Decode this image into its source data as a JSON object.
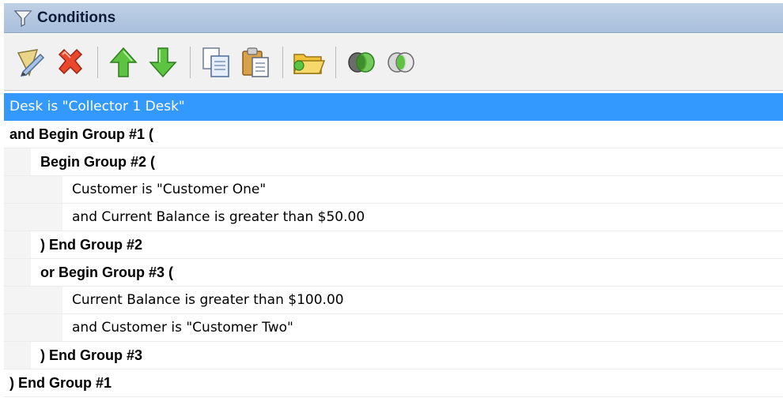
{
  "panel": {
    "title": "Conditions",
    "title_icon": "funnel-icon"
  },
  "toolbar": {
    "buttons": [
      {
        "icon": "edit-condition-icon"
      },
      {
        "icon": "delete-icon"
      },
      {
        "icon": "move-up-icon"
      },
      {
        "icon": "move-down-icon"
      },
      {
        "icon": "copy-icon"
      },
      {
        "icon": "paste-icon"
      },
      {
        "icon": "folder-icon"
      },
      {
        "icon": "group-icon"
      },
      {
        "icon": "ungroup-icon"
      }
    ]
  },
  "conditions": [
    {
      "text": "Desk is \"Collector 1 Desk\"",
      "level": 0,
      "kind": "condition",
      "selected": true
    },
    {
      "text": "and Begin Group #1 (",
      "level": 0,
      "kind": "group",
      "selected": false
    },
    {
      "text": "Begin Group #2 (",
      "level": 1,
      "kind": "group",
      "selected": false
    },
    {
      "text": "Customer is \"Customer One\"",
      "level": 2,
      "kind": "condition",
      "selected": false
    },
    {
      "text": "and Current Balance is greater than $50.00",
      "level": 2,
      "kind": "condition",
      "selected": false
    },
    {
      "text": ") End Group #2",
      "level": 1,
      "kind": "group",
      "selected": false
    },
    {
      "text": "or Begin Group #3 (",
      "level": 1,
      "kind": "group",
      "selected": false
    },
    {
      "text": "Current Balance is greater than $100.00",
      "level": 2,
      "kind": "condition",
      "selected": false
    },
    {
      "text": "and Customer is \"Customer Two\"",
      "level": 2,
      "kind": "condition",
      "selected": false
    },
    {
      "text": ") End Group #3",
      "level": 1,
      "kind": "group",
      "selected": false
    },
    {
      "text": ") End Group #1",
      "level": 0,
      "kind": "group",
      "selected": false
    }
  ],
  "colors": {
    "selection": "#3399ff",
    "title_bar": "#b3c6e0",
    "toolbar": "#f1f1f1"
  }
}
